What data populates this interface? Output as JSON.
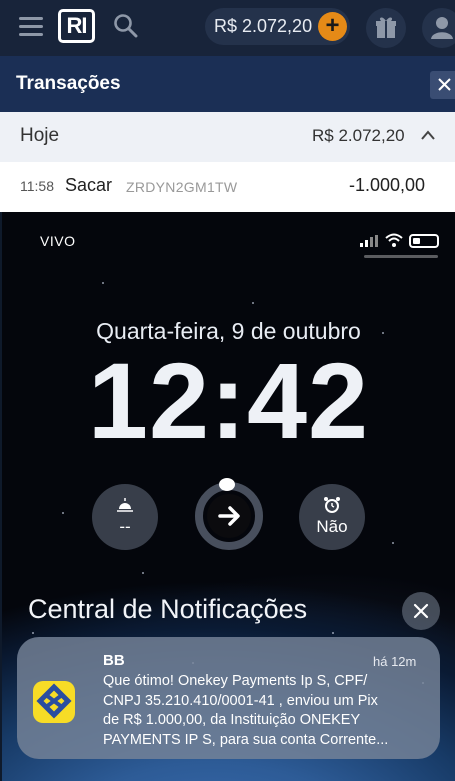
{
  "appbar": {
    "logo_text": "RI",
    "balance": "R$ 2.072,20",
    "plus_symbol": "+"
  },
  "transactions": {
    "title": "Transações",
    "close_symbol": "✕",
    "group": {
      "label": "Hoje",
      "total": "R$ 2.072,20"
    },
    "rows": [
      {
        "time": "11:58",
        "type": "Sacar",
        "id": "ZRDYN2GM1TW",
        "amount": "-1.000,00"
      }
    ]
  },
  "lock_screen": {
    "carrier": "VIVO",
    "date": "Quarta-feira, 9 de outubro",
    "time": "12:42",
    "widgets": {
      "left_value": "--",
      "right_value": "Não"
    },
    "notification_center_title": "Central de Notificações",
    "notification": {
      "app": "BB",
      "time": "há 12m",
      "lines": [
        "Que ótimo! Onekey Payments Ip S, CPF/",
        "CNPJ 35.210.410/0001-41 , enviou um Pix",
        "de R$  1.000,00, da Instituição ONEKEY",
        "PAYMENTS IP S, para sua conta Corrente..."
      ]
    }
  },
  "colors": {
    "appbar_bg": "#18243a",
    "header_bg": "#1b2f55",
    "accent_orange": "#e58a17",
    "bb_yellow": "#f7dc26",
    "bb_blue": "#2a4ea0"
  }
}
